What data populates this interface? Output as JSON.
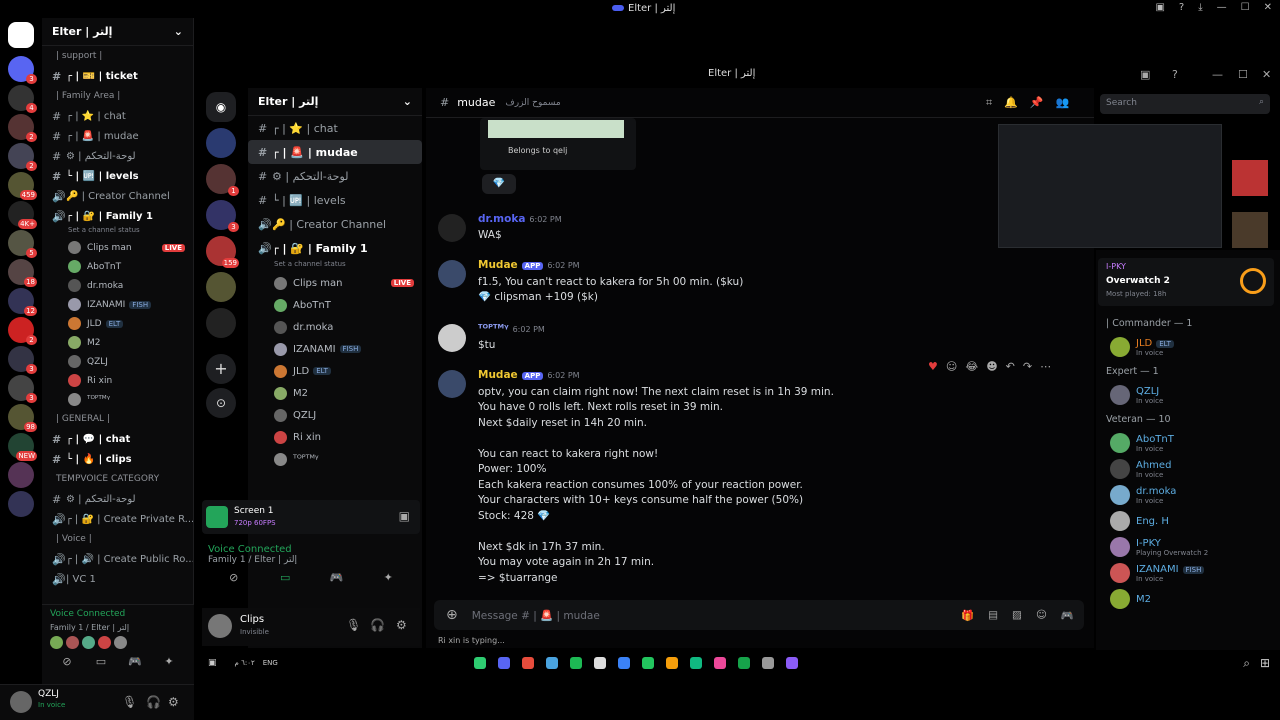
{
  "window": {
    "title": "Elter | إلتر"
  },
  "outer": {
    "guild_name": "Elter | إلتر",
    "channels": [
      {
        "label": "| support |",
        "kind": "cat"
      },
      {
        "label": "┌ | 🎫 | ticket",
        "kind": "text",
        "active": true
      },
      {
        "label": "| Family Area |",
        "kind": "cat"
      },
      {
        "label": "┌ | ⭐ | chat",
        "kind": "text"
      },
      {
        "label": "┌ | 🚨 | mudae",
        "kind": "text"
      },
      {
        "label": "⚙ | لوحة-التحكم",
        "kind": "text"
      },
      {
        "label": "└ | 🆙 | levels",
        "kind": "text",
        "active": true
      },
      {
        "label": "🔑 | Creator Channel",
        "kind": "voice"
      },
      {
        "label": "┌ | 🔐 | Family 1",
        "kind": "voice",
        "active": true
      }
    ],
    "channel_status": "Set a channel status",
    "voice_users": [
      {
        "name": "Clips man",
        "live": "LIVE"
      },
      {
        "name": "AboTnT"
      },
      {
        "name": "dr.moka"
      },
      {
        "name": "IZANAMI",
        "tag": "FISH"
      },
      {
        "name": "JLD",
        "tag": "ELT"
      },
      {
        "name": "M2"
      },
      {
        "name": "QZLJ"
      },
      {
        "name": "Ri xin"
      },
      {
        "name": "ᵀᴼᴾᵀᴹᵞ"
      }
    ],
    "channels2": [
      {
        "label": "| GENERAL |",
        "kind": "cat"
      },
      {
        "label": "┌ | 💬 | chat",
        "kind": "text",
        "active": true
      },
      {
        "label": "└ | 🔥 | clips",
        "kind": "text",
        "active": true
      },
      {
        "label": "TEMPVOICE CATEGORY",
        "kind": "cat"
      },
      {
        "label": "⚙ | لوحة-التحكم",
        "kind": "text"
      },
      {
        "label": "┌ | 🔐 | Create Private R...",
        "kind": "voice"
      },
      {
        "label": "| Voice |",
        "kind": "cat"
      },
      {
        "label": "┌ | 🔊 | Create Public Ro...",
        "kind": "voice"
      },
      {
        "label": "| VC 1",
        "kind": "voice"
      }
    ],
    "voice_connected": "Voice Connected",
    "voice_path": "Family 1 / Elter | إلتر",
    "user": {
      "name": "QZLJ",
      "status": "In voice"
    },
    "rail_badges": [
      "3",
      "4",
      "2",
      "2",
      "459",
      "4K+",
      "5",
      "18",
      "12",
      "2",
      "3",
      "3",
      "98",
      "NEW"
    ]
  },
  "inner": {
    "title": "Elter | إلتر",
    "guild_name": "Elter | إلتر",
    "channels": [
      {
        "label": "┌ | ⭐ | chat"
      },
      {
        "label": "┌ | 🚨 | mudae",
        "active": true
      },
      {
        "label": "⚙ | لوحة-التحكم"
      },
      {
        "label": "└ | 🆙 | levels"
      },
      {
        "label": "🔑 | Creator Channel"
      },
      {
        "label": "┌ | 🔐 | Family 1",
        "active": true
      }
    ],
    "channel_status": "Set a channel status",
    "voice_users": [
      {
        "name": "Clips man",
        "live": "LIVE"
      },
      {
        "name": "AboTnT"
      },
      {
        "name": "dr.moka"
      },
      {
        "name": "IZANAMI",
        "tag": "FISH"
      },
      {
        "name": "JLD",
        "tag": "ELT"
      },
      {
        "name": "M2"
      },
      {
        "name": "QZLJ"
      },
      {
        "name": "Ri xin"
      },
      {
        "name": "ᵀᴼᴾᵀᴹᵞ"
      }
    ],
    "rail_badges": [
      "1",
      "3",
      "159"
    ],
    "screen": {
      "label": "Screen 1",
      "sub": "720p 60FPS"
    },
    "voice_connected": "Voice Connected",
    "voice_path": "Family 1 / Elter | إلتر",
    "user": {
      "name": "Clips",
      "status": "Invisible"
    },
    "chat": {
      "channel": "mudae",
      "topic": "مسموح الزرف",
      "search_placeholder": "Search",
      "belongs": "Belongs to qelj",
      "input_placeholder": "Message # | 🚨 | mudae",
      "typing": "Ri xin is typing...",
      "messages": [
        {
          "author": "dr.moka",
          "color": "#5865f2",
          "time": "6:02 PM",
          "lines": [
            "WA$"
          ]
        },
        {
          "author": "Mudae",
          "app": "APP",
          "color": "#f0c832",
          "time": "6:02 PM",
          "lines": [
            "f1.5, You can't react to kakera for 5h 00 min. ($ku)",
            "💎 clipsman +109 ($k)"
          ]
        },
        {
          "author": "ᵀᴼᴾᵀᴹᵞ",
          "color": "#8c9cf0",
          "time": "6:02 PM",
          "lines": [
            "$tu"
          ]
        },
        {
          "author": "Mudae",
          "app": "APP",
          "color": "#f0c832",
          "time": "6:02 PM",
          "lines": [
            "optv, you can claim right now! The next claim reset is in 1h 39 min.",
            "You have 0 rolls left. Next rolls reset in 39 min.",
            "Next $daily reset in 14h 20 min.",
            "",
            "You can react to kakera right now!",
            "Power: 100%",
            "Each kakera reaction consumes 100% of your reaction power.",
            "Your characters with 10+ keys consume half the power (50%)",
            "Stock: 428 💎",
            "",
            "Next $dk in 17h 37 min.",
            "You may vote again in 2h 17 min.",
            "=> $tuarrange"
          ]
        }
      ]
    },
    "members": {
      "game": {
        "user": "I-PKY",
        "title": "Overwatch 2",
        "sub": "Most played: 18h"
      },
      "groups": [
        {
          "label": "| Commander — 1",
          "items": [
            {
              "name": "JLD",
              "tag": "ELT",
              "sub": "In voice",
              "color": "#e67e22"
            }
          ]
        },
        {
          "label": "Expert — 1",
          "items": [
            {
              "name": "QZLJ",
              "sub": "In voice",
              "color": "#5dade2"
            }
          ]
        },
        {
          "label": "Veteran — 10",
          "items": [
            {
              "name": "AboTnT",
              "sub": "In voice",
              "color": "#5dade2"
            },
            {
              "name": "Ahmed",
              "sub": "In voice",
              "color": "#5dade2"
            },
            {
              "name": "dr.moka",
              "sub": "In voice",
              "color": "#5dade2"
            },
            {
              "name": "Eng. H",
              "sub": "",
              "color": "#5dade2"
            },
            {
              "name": "I-PKY",
              "sub": "Playing Overwatch 2",
              "color": "#5dade2"
            },
            {
              "name": "IZANAMI",
              "tag": "FISH",
              "sub": "In voice",
              "color": "#5dade2"
            },
            {
              "name": "M2",
              "sub": "",
              "color": "#5dade2"
            }
          ]
        }
      ]
    }
  },
  "taskbar": {
    "lang": "ENG",
    "time": "٦:٠٢ م",
    "date": "٢٥/١٢/٢٠٢٤"
  },
  "colors": {
    "accent": "#5865f2",
    "live": "#e23c3c",
    "green": "#23a55a",
    "mudae": "#f0c832"
  }
}
